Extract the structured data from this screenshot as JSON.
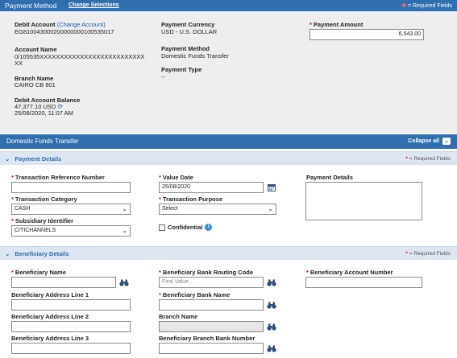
{
  "header": {
    "title": "Payment Method",
    "change_link": "Change Selections",
    "required_fields": "= Required Fields"
  },
  "account": {
    "debit_account_label": "Debit Account",
    "change_account_link": "(Change Account)",
    "debit_account_value": "EG810043000200000000100535017",
    "account_name_label": "Account Name",
    "account_name_value_1": "0/105535XXXXXXXXXXXXXXXXXXXXXXXXXX",
    "account_name_value_2": "XX",
    "branch_name_label": "Branch Name",
    "branch_name_value": "CAIRO CB 801",
    "balance_label": "Debit Account Balance",
    "balance_value": "47,377.10 USD",
    "balance_time": "25/08/2020, 11:07 AM",
    "currency_label": "Payment Currency",
    "currency_value": "USD - U.S. DOLLAR",
    "method_label": "Payment Method",
    "method_value": "Domestic Funds Transfer",
    "type_label": "Payment Type",
    "type_value": "--",
    "amount_label": "Payment Amount",
    "amount_value": "6,543.00"
  },
  "dft": {
    "title": "Domestic Funds Transfer",
    "collapse_all": "Collapse all"
  },
  "payment_details": {
    "title": "Payment Details",
    "required_fields": "= Required Fields",
    "txn_ref_label": "Transaction Reference Number",
    "txn_ref_value": "",
    "value_date_label": "Value Date",
    "value_date_value": "25/08/2020",
    "payment_details_label": "Payment Details",
    "payment_details_value": "",
    "txn_category_label": "Transaction Category",
    "txn_category_value": "CASH",
    "txn_purpose_label": "Transaction Purpose",
    "txn_purpose_value": "Select",
    "subsidiary_label": "Subsidiary Identifier",
    "subsidiary_value": "CITICHANNELS",
    "confidential_label": "Confidential"
  },
  "beneficiary": {
    "title": "Beneficiary Details",
    "required_fields": "= Required Fields",
    "name_label": "Beneficiary Name",
    "routing_label": "Beneficiary Bank Routing Code",
    "routing_placeholder": "Find Value...",
    "account_number_label": "Beneficiary Account Number",
    "addr1_label": "Beneficiary Address Line 1",
    "bank_name_label": "Beneficiary Bank Name",
    "addr2_label": "Beneficiary Address Line 2",
    "branch_name_label": "Branch Name",
    "addr3_label": "Beneficiary Address Line 3",
    "branch_bank_number_label": "Beneficiary Branch Bank Number"
  },
  "colors": {
    "header_bar": "#2f6fb0",
    "section_bar": "#dde6f0",
    "required": "#c8102e",
    "link": "#1a5aa6"
  }
}
